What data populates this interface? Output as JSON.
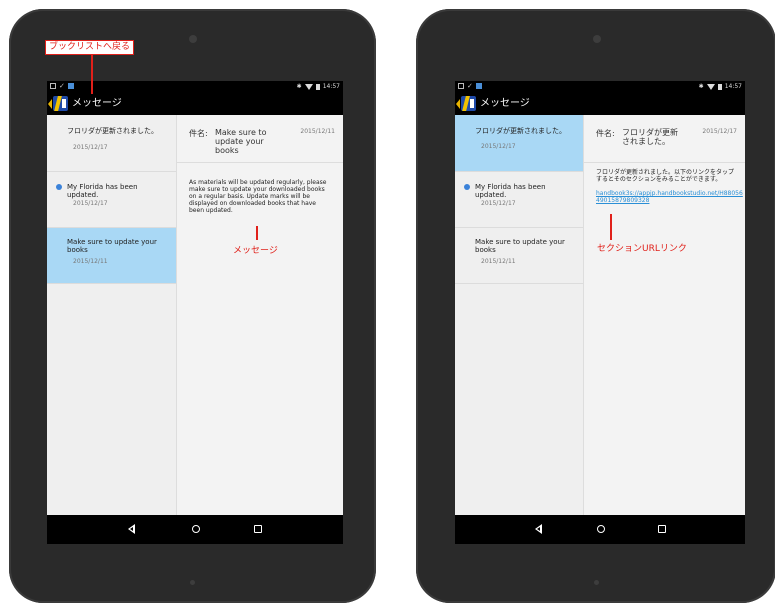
{
  "annotations": {
    "back_to_booklist": "ブックリストへ戻る",
    "message": "メッセージ",
    "section_url_link": "セクションURLリンク"
  },
  "status_bar": {
    "time": "14:57",
    "bluetooth_symbol": "✱",
    "notification_icons": [
      "screenshot-icon",
      "check-icon",
      "image-icon"
    ]
  },
  "action_bar": {
    "title": "メッセージ",
    "app_icon": "handbook-app-icon"
  },
  "messages": [
    {
      "title": "フロリダが更新されました。",
      "date": "2015/12/17",
      "unread": false
    },
    {
      "title": "My Florida has been updated.",
      "date": "2015/12/17",
      "unread": true
    },
    {
      "title": "Make sure to update your books",
      "date": "2015/12/11",
      "unread": false
    }
  ],
  "screens": {
    "left": {
      "selected_index": 2,
      "detail": {
        "subject_label": "件名:",
        "subject": "Make sure to update your books",
        "date": "2015/12/11",
        "body": "As materials will be updated regularly, please make sure to update your downloaded books on a regular basis. Update marks will be displayed on downloaded books that have been updated."
      }
    },
    "right": {
      "selected_index": 0,
      "detail": {
        "subject_label": "件名:",
        "subject": "フロリダが更新されました。",
        "date": "2015/12/17",
        "body": "フロリダが更新されました。以下のリンクをタップするとそのセクションをみることができます。",
        "link": "handbook3s://appjp.handbookstudio.net/H8805649015879809328"
      }
    }
  },
  "nav_bar": {
    "buttons": [
      "back-icon",
      "home-icon",
      "recent-apps-icon"
    ]
  },
  "colors": {
    "bezel": "#2a2a2a",
    "selected_item": "#a9d8f5",
    "unread_dot": "#3b82d9",
    "link": "#2a8fd6",
    "annotation": "#e0201a",
    "app_bar": "#000000"
  }
}
